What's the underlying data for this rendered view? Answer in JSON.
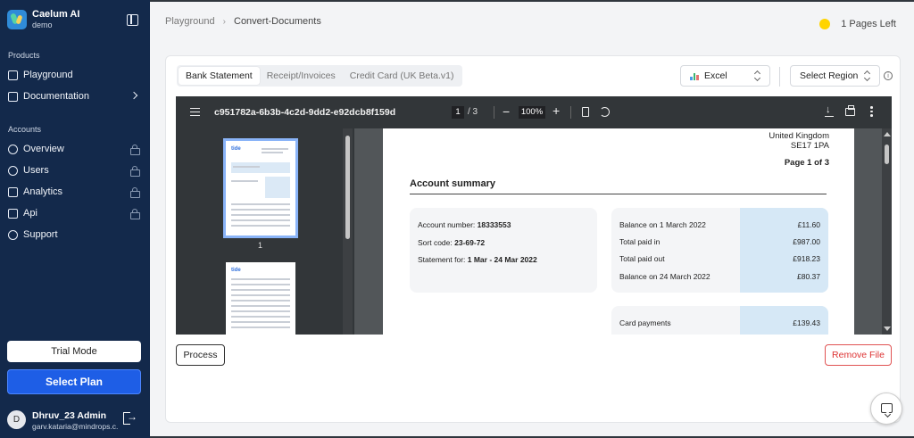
{
  "brand": {
    "name": "Caelum AI",
    "subtitle": "demo"
  },
  "sidebar": {
    "products_label": "Products",
    "products": [
      {
        "label": "Playground",
        "icon": "playground-icon"
      },
      {
        "label": "Documentation",
        "icon": "book-icon"
      }
    ],
    "accounts_label": "Accounts",
    "accounts": [
      {
        "label": "Overview",
        "icon": "overview-icon",
        "locked": true
      },
      {
        "label": "Users",
        "icon": "users-icon",
        "locked": true
      },
      {
        "label": "Analytics",
        "icon": "analytics-icon",
        "locked": true
      },
      {
        "label": "Api",
        "icon": "api-icon",
        "locked": true
      },
      {
        "label": "Support",
        "icon": "support-icon",
        "locked": false
      }
    ],
    "trial_label": "Trial Mode",
    "plan_label": "Select Plan",
    "user": {
      "initial": "D",
      "name": "Dhruv_23 Admin",
      "email": "garv.kataria@mindrops.c..."
    }
  },
  "breadcrumb": {
    "root": "Playground",
    "current": "Convert-Documents"
  },
  "pages_left": "1 Pages Left",
  "tabs": [
    {
      "label": "Bank Statement",
      "active": true
    },
    {
      "label": "Receipt/Invoices",
      "active": false
    },
    {
      "label": "Credit Card (UK Beta.v1)",
      "active": false
    }
  ],
  "format_select": {
    "value": "Excel"
  },
  "region_select": {
    "value": "Select Region"
  },
  "viewer": {
    "file_name": "c951782a-6b3b-4c2d-9dd2-e92dcb8f159d",
    "current_page": "1",
    "total_pages": "/ 3",
    "zoom": "100%",
    "thumb_label": "1",
    "thumb_logo": "tide"
  },
  "document": {
    "address_line1": "United Kingdom",
    "address_line2": "SE17 1PA",
    "page_of": "Page 1 of 3",
    "summary_title": "Account summary",
    "account_number_label": "Account number:",
    "account_number": "18333553",
    "sort_code_label": "Sort code:",
    "sort_code": "23-69-72",
    "statement_label": "Statement for:",
    "statement_period": "1 Mar - 24 Mar 2022",
    "balances": [
      {
        "label": "Balance on 1 March 2022",
        "value": "£11.60"
      },
      {
        "label": "Total paid in",
        "value": "£987.00"
      },
      {
        "label": "Total paid out",
        "value": "£918.23"
      },
      {
        "label": "Balance on 24 March 2022",
        "value": "£80.37"
      }
    ],
    "card_payments_label": "Card payments",
    "card_payments_value": "£139.43"
  },
  "actions": {
    "process": "Process",
    "remove": "Remove File"
  },
  "colors": {
    "sidebar": "#13294b",
    "accent": "#1e5ee6",
    "danger": "#e05252",
    "coin": "#ffd400"
  }
}
